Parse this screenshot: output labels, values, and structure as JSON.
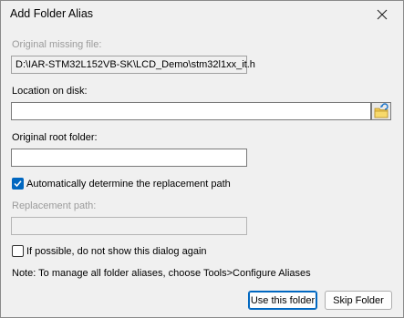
{
  "window": {
    "title": "Add Folder Alias"
  },
  "fields": {
    "original_missing_file": {
      "label": "Original missing file:",
      "value": "D:\\IAR-STM32L152VB-SK\\LCD_Demo\\stm32l1xx_it.h"
    },
    "location_on_disk": {
      "label": "Location on disk:",
      "value": ""
    },
    "original_root_folder": {
      "label": "Original root folder:",
      "value": ""
    },
    "replacement_path": {
      "label": "Replacement path:",
      "value": ""
    }
  },
  "checkboxes": {
    "auto_determine": {
      "label": "Automatically determine the replacement path",
      "checked": true
    },
    "dont_show_again": {
      "label": "If possible, do not show this dialog again",
      "checked": false
    }
  },
  "note": "Note: To manage all folder aliases, choose Tools>Configure Aliases",
  "buttons": {
    "use_folder": "Use this folder",
    "skip_folder": "Skip Folder"
  },
  "icons": {
    "close": "close-icon",
    "browse": "folder-browse-icon",
    "check": "checkmark-icon"
  },
  "colors": {
    "accent": "#0067c0",
    "disabled_text": "#9b9b9b",
    "background": "#f0f0f0"
  }
}
